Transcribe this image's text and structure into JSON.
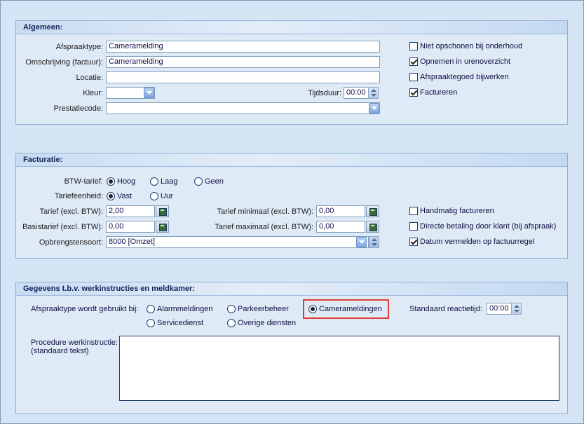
{
  "algemeen": {
    "title": "Algemeen:",
    "afspraaktype_label": "Afspraaktype:",
    "afspraaktype_value": "Camerameldi​ng",
    "omschrijving_label": "Omschrijving (factuur):",
    "omschrijving_value": "Cameramelding",
    "locatie_label": "Locatie:",
    "locatie_value": "",
    "kleur_label": "Kleur:",
    "tijdsduur_label": "Tijdsduur:",
    "tijdsduur_value": "00:00",
    "prestatiecode_label": "Prestatiecode:",
    "prestatiecode_value": "",
    "checkboxes": [
      {
        "label": "Niet opschonen bij onderhoud",
        "checked": false
      },
      {
        "label": "Opnemen in urenoverzicht",
        "checked": true
      },
      {
        "label": "Afspraaktegoed bijwerken",
        "checked": false
      },
      {
        "label": "Factureren",
        "checked": true
      }
    ]
  },
  "facturatie": {
    "title": "Facturatie:",
    "btw_label": "BTW-tarief:",
    "btw_options": [
      {
        "label": "Hoog",
        "selected": true
      },
      {
        "label": "Laag",
        "selected": false
      },
      {
        "label": "Geen",
        "selected": false
      }
    ],
    "tariefeenheid_label": "Tariefeenheid:",
    "tariefeenheid_options": [
      {
        "label": "Vast",
        "selected": true
      },
      {
        "label": "Uur",
        "selected": false
      }
    ],
    "tarief_label": "Tarief (excl. BTW):",
    "tarief_value": "2,00",
    "basistarief_label": "Basistarief (excl. BTW):",
    "basistarief_value": "0,00",
    "tarief_min_label": "Tarief minimaal (excl. BTW):",
    "tarief_min_value": "0,00",
    "tarief_max_label": "Tarief maximaal (excl. BTW):",
    "tarief_max_value": "0,00",
    "opbrengstensoort_label": "Opbrengstensoort:",
    "opbrengstensoort_value": "8000 [Omzet]",
    "checkboxes": [
      {
        "label": "Handmatig factureren",
        "checked": false
      },
      {
        "label": "Directe betaling door klant (bij afspraak)",
        "checked": false
      },
      {
        "label": "Datum vermelden op factuurregel",
        "checked": true
      }
    ]
  },
  "werkinstructies": {
    "title": "Gegevens t.b.v. werkinstructies en meldkamer:",
    "gebruikt_label": "Afspraaktype wordt gebruikt bij:",
    "options": [
      {
        "label": "Alarmmeldingen",
        "selected": false
      },
      {
        "label": "Parkeerbeheer",
        "selected": false
      },
      {
        "label": "Camerameldingen",
        "selected": true
      },
      {
        "label": "Servicedienst",
        "selected": false
      },
      {
        "label": "Overige diensten",
        "selected": false
      }
    ],
    "reactietijd_label": "Standaard reactietijd:",
    "reactietijd_value": "00:00",
    "procedure_label_1": "Procedure werkinstructie:",
    "procedure_label_2": "(standaard tekst)",
    "procedure_value": ""
  }
}
